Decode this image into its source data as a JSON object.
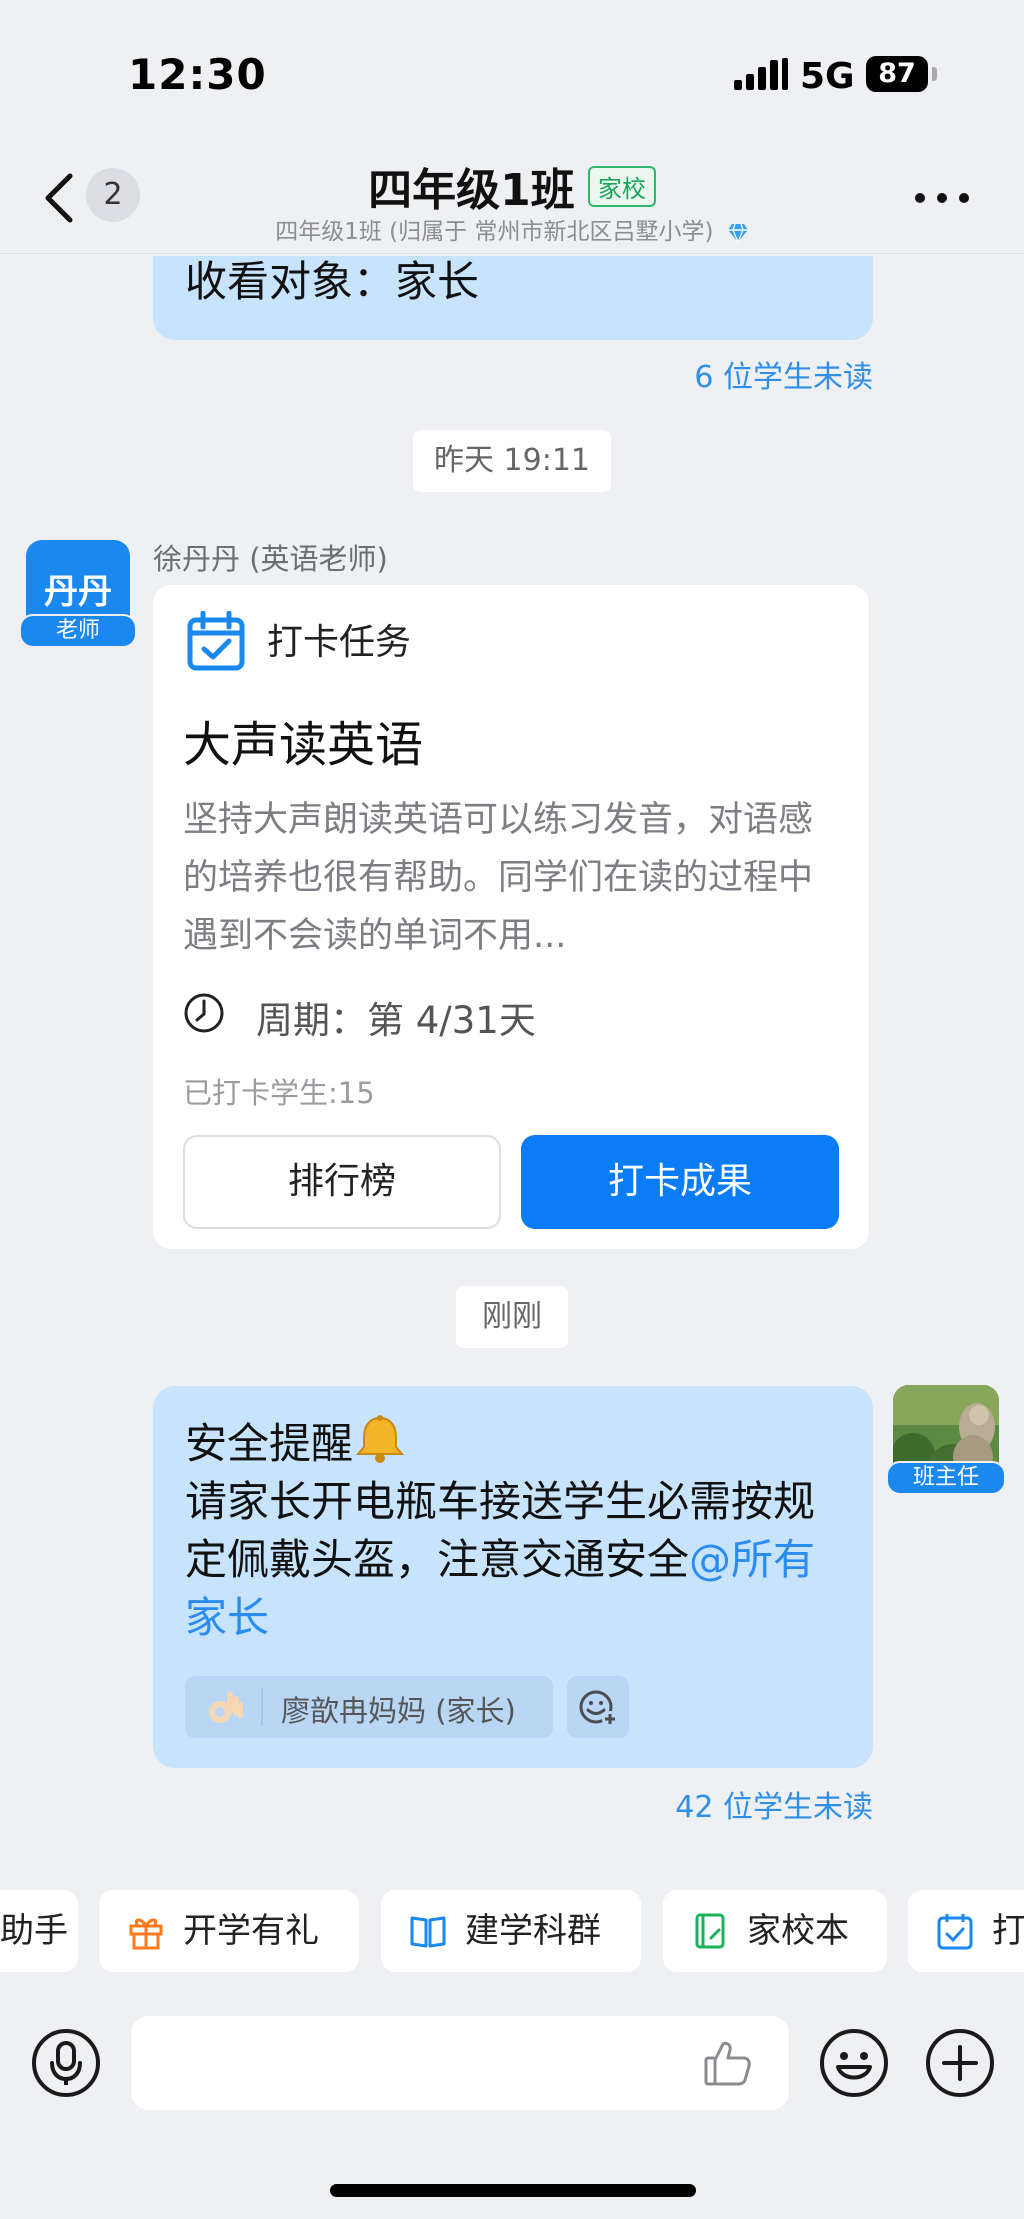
{
  "status_bar": {
    "time": "12:30",
    "network": "5G",
    "battery": "87"
  },
  "nav": {
    "unread": "2",
    "title": "四年级1班",
    "tag": "家校",
    "subtitle": "四年级1班 (归属于 常州市新北区吕墅小学)"
  },
  "messages": {
    "prev_bubble_text": "收看对象：家长",
    "prev_read_status": "6 位学生未读",
    "time_1": "昨天 19:11",
    "teacher": {
      "avatar_name": "丹丹",
      "avatar_badge": "老师",
      "sender": "徐丹丹 (英语老师)"
    },
    "card": {
      "type": "打卡任务",
      "title": "大声读英语",
      "description": "坚持大声朗读英语可以练习发音，对语感的培养也很有帮助。同学们在读的过程中遇到不会读的单词不用...",
      "period": "周期：第 4/31天",
      "checked_count": "已打卡学生:15",
      "ranking_button": "排行榜",
      "results_button": "打卡成果"
    },
    "time_2": "刚刚",
    "own": {
      "avatar_badge": "班主任",
      "line1": "安全提醒",
      "line2": "请家长开电瓶车接送学生必需按规定佩戴头盔，注意交通安全",
      "mention": "@所有家长",
      "reaction_user": "廖歆冉妈妈 (家长)",
      "read_status": "42 位学生未读"
    }
  },
  "shortcuts": [
    {
      "label": "助手",
      "icon": "assistant-icon"
    },
    {
      "label": "开学有礼",
      "icon": "gift-icon"
    },
    {
      "label": "建学科群",
      "icon": "book-icon"
    },
    {
      "label": "家校本",
      "icon": "notebook-icon"
    },
    {
      "label": "打",
      "icon": "checkin-icon"
    }
  ],
  "colors": {
    "accent": "#0a7cf5",
    "bubble": "#c8e4fd",
    "tag_green": "#1aa35a",
    "background": "#eff0f3"
  }
}
